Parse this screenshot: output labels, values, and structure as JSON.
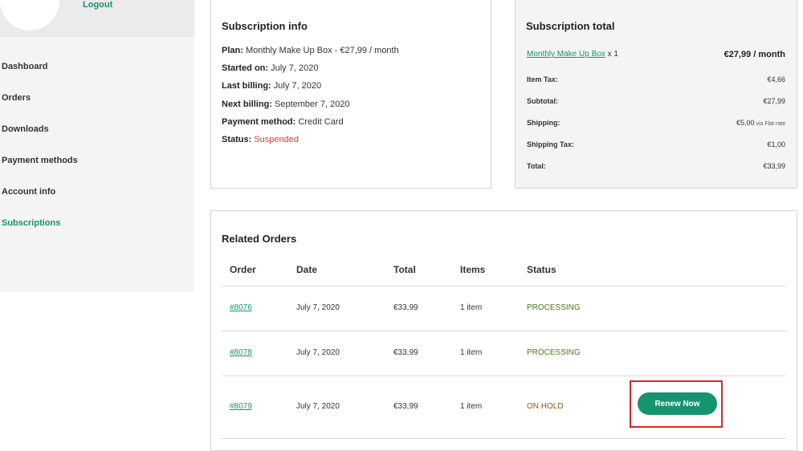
{
  "account": {
    "logout_label": "Logout"
  },
  "nav": {
    "items": [
      {
        "label": "Dashboard"
      },
      {
        "label": "Orders"
      },
      {
        "label": "Downloads"
      },
      {
        "label": "Payment methods"
      },
      {
        "label": "Account info"
      },
      {
        "label": "Subscriptions",
        "active": true
      }
    ]
  },
  "subscription_info": {
    "title": "Subscription info",
    "plan_label": "Plan:",
    "plan_value": "Monthly Make Up Box - €27,99 / month",
    "started_label": "Started on:",
    "started_value": "July 7, 2020",
    "last_billing_label": "Last billing:",
    "last_billing_value": "July 7, 2020",
    "next_billing_label": "Next billing:",
    "next_billing_value": "September 7, 2020",
    "payment_label": "Payment method:",
    "payment_value": "Credit Card",
    "status_label": "Status:",
    "status_value": "Suspended"
  },
  "subscription_total": {
    "title": "Subscription total",
    "product_name": "Monthly Make Up Box",
    "product_qty": " x 1",
    "product_price": "€27,99 / month",
    "rows": [
      {
        "label": "Item Tax:",
        "value": "€4,66",
        "note": ""
      },
      {
        "label": "Subtotal:",
        "value": "€27,99",
        "note": ""
      },
      {
        "label": "Shipping:",
        "value": "€5,00",
        "note": " via Flat rate"
      },
      {
        "label": "Shipping Tax:",
        "value": "€1,00",
        "note": ""
      },
      {
        "label": "Total:",
        "value": "€33,99",
        "note": ""
      }
    ]
  },
  "related_orders": {
    "title": "Related Orders",
    "columns": [
      "Order",
      "Date",
      "Total",
      "Items",
      "Status"
    ],
    "rows": [
      {
        "order": "#8076",
        "date": "July 7, 2020",
        "total": "€33,99",
        "items": "1 item",
        "status": "PROCESSING"
      },
      {
        "order": "#8078",
        "date": "July 7, 2020",
        "total": "€33,99",
        "items": "1 item",
        "status": "PROCESSING"
      },
      {
        "order": "#8079",
        "date": "July 7, 2020",
        "total": "€33,99",
        "items": "1 item",
        "status": "ON HOLD"
      }
    ],
    "renew_label": "Renew Now"
  },
  "colors": {
    "accent": "#15946f",
    "suspended": "#e03a2f",
    "processing": "#4d7a1f",
    "on_hold": "#8a5a14",
    "highlight": "#d9262b"
  }
}
